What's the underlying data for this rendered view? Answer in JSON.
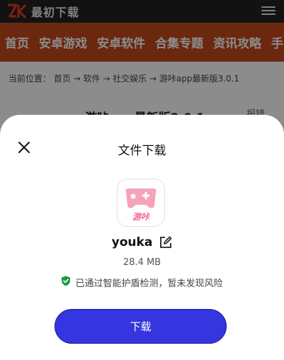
{
  "site": {
    "logo_text": "最初下载",
    "nav": [
      "首页",
      "安卓游戏",
      "安卓软件",
      "合集专题",
      "资讯攻略",
      "手"
    ]
  },
  "breadcrumb": "当前位置： 首页 → 软件 → 社交娱乐 → 游咔app最新版3.0.1",
  "page": {
    "title": "游咔app最新版3.0.1",
    "report": "报错"
  },
  "dialog": {
    "title": "文件下载",
    "app_icon_text": "游咔",
    "app_name": "youka",
    "app_size": "28.4 MB",
    "security_text": "已通过智能护盾检测，暂未发现风险",
    "download_label": "下载"
  },
  "colors": {
    "nav_bg": "#c44a1c",
    "primary_button": "#3536e0",
    "shield_green": "#1a9b4a",
    "icon_pink": "#f06a8e"
  },
  "icons": [
    "logo-icon",
    "menu-icon",
    "close-icon",
    "game-controller-icon",
    "edit-icon",
    "shield-check-icon"
  ]
}
